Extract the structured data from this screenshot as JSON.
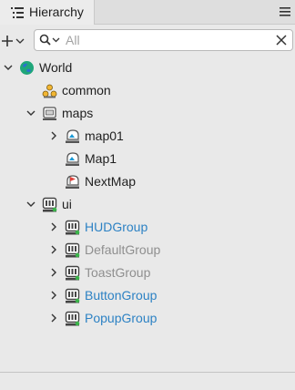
{
  "panel": {
    "title": "Hierarchy"
  },
  "search": {
    "placeholder": "All",
    "value": ""
  },
  "tree": [
    {
      "label": "World",
      "icon": "globe-icon",
      "expanded": true,
      "style": "normal"
    },
    {
      "label": "common",
      "icon": "shared-prefab-icon",
      "style": "normal"
    },
    {
      "label": "maps",
      "icon": "scene-folder-icon",
      "expanded": true,
      "style": "normal"
    },
    {
      "label": "map01",
      "icon": "map-icon",
      "expanded": false,
      "style": "normal"
    },
    {
      "label": "Map1",
      "icon": "map-icon",
      "style": "normal"
    },
    {
      "label": "NextMap",
      "icon": "map-flag-icon",
      "style": "normal"
    },
    {
      "label": "ui",
      "icon": "ui-icon",
      "expanded": true,
      "style": "normal"
    },
    {
      "label": "HUDGroup",
      "icon": "ui-group-icon",
      "expanded": false,
      "style": "blue"
    },
    {
      "label": "DefaultGroup",
      "icon": "ui-group-icon",
      "expanded": false,
      "style": "gray"
    },
    {
      "label": "ToastGroup",
      "icon": "ui-group-icon",
      "expanded": false,
      "style": "gray"
    },
    {
      "label": "ButtonGroup",
      "icon": "ui-group-icon",
      "expanded": false,
      "style": "blue"
    },
    {
      "label": "PopupGroup",
      "icon": "ui-group-icon",
      "expanded": false,
      "style": "blue"
    }
  ],
  "colors": {
    "link": "#2d82c4",
    "disabled": "#8f8f8f",
    "globe": "#1fa67a"
  }
}
